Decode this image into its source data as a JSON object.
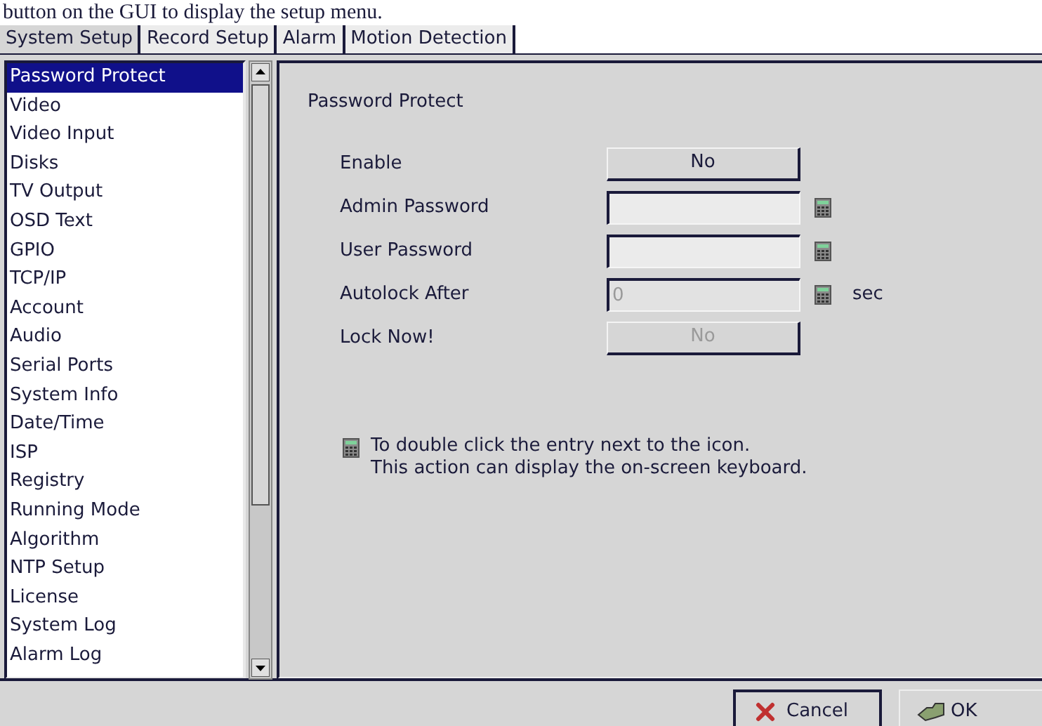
{
  "document_text": "button on the GUI to display the setup menu.",
  "tabs": [
    {
      "label": "System Setup",
      "selected": true
    },
    {
      "label": "Record Setup",
      "selected": false
    },
    {
      "label": "Alarm",
      "selected": false
    },
    {
      "label": "Motion Detection",
      "selected": false
    }
  ],
  "menu": {
    "items": [
      {
        "label": "Password Protect",
        "selected": true
      },
      {
        "label": "Video",
        "selected": false
      },
      {
        "label": "Video Input",
        "selected": false
      },
      {
        "label": "Disks",
        "selected": false
      },
      {
        "label": "TV Output",
        "selected": false
      },
      {
        "label": "OSD Text",
        "selected": false
      },
      {
        "label": "GPIO",
        "selected": false
      },
      {
        "label": "TCP/IP",
        "selected": false
      },
      {
        "label": "Account",
        "selected": false
      },
      {
        "label": "Audio",
        "selected": false
      },
      {
        "label": "Serial Ports",
        "selected": false
      },
      {
        "label": "System Info",
        "selected": false
      },
      {
        "label": "Date/Time",
        "selected": false
      },
      {
        "label": "ISP",
        "selected": false
      },
      {
        "label": "Registry",
        "selected": false
      },
      {
        "label": "Running Mode",
        "selected": false
      },
      {
        "label": "Algorithm",
        "selected": false
      },
      {
        "label": "NTP Setup",
        "selected": false
      },
      {
        "label": "License",
        "selected": false
      },
      {
        "label": "System Log",
        "selected": false
      },
      {
        "label": "Alarm Log",
        "selected": false
      }
    ]
  },
  "panel": {
    "title": "Password Protect",
    "rows": [
      {
        "kind": "toggle",
        "label": "Enable",
        "value": "No",
        "disabled": false
      },
      {
        "kind": "field",
        "label": "Admin Password"
      },
      {
        "kind": "field",
        "label": "User Password"
      },
      {
        "kind": "field",
        "label": "Autolock After",
        "value": "0",
        "disabled": true,
        "unit": "sec"
      },
      {
        "kind": "toggle",
        "label": "Lock Now!",
        "value": "No",
        "disabled": true
      }
    ],
    "note": [
      "To double click the entry next to the icon.",
      "This action can display the on-screen keyboard."
    ]
  },
  "buttons": [
    {
      "kind": "cancel",
      "label": "Cancel"
    },
    {
      "kind": "ok",
      "label": "OK"
    }
  ]
}
